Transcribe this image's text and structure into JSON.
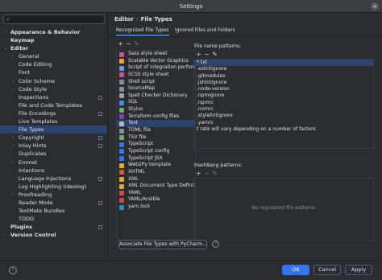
{
  "window": {
    "title": "Settings",
    "close_glyph": "×"
  },
  "search": {
    "glyph": "⌕"
  },
  "tree": [
    {
      "label": "Appearance & Behavior",
      "level": 0,
      "arrow": "›",
      "bold": true
    },
    {
      "label": "Keymap",
      "level": 0,
      "arrow": "",
      "bold": true
    },
    {
      "label": "Editor",
      "level": 0,
      "arrow": "⌄",
      "bold": true
    },
    {
      "label": "General",
      "level": 1,
      "arrow": "›"
    },
    {
      "label": "Code Editing",
      "level": 1,
      "arrow": ""
    },
    {
      "label": "Font",
      "level": 1,
      "arrow": ""
    },
    {
      "label": "Color Scheme",
      "level": 1,
      "arrow": "›"
    },
    {
      "label": "Code Style",
      "level": 1,
      "arrow": "›"
    },
    {
      "label": "Inspections",
      "level": 1,
      "arrow": "",
      "pin": true
    },
    {
      "label": "File and Code Templates",
      "level": 1,
      "arrow": ""
    },
    {
      "label": "File Encodings",
      "level": 1,
      "arrow": "",
      "pin": true
    },
    {
      "label": "Live Templates",
      "level": 1,
      "arrow": ""
    },
    {
      "label": "File Types",
      "level": 1,
      "arrow": "",
      "selected": true
    },
    {
      "label": "Copyright",
      "level": 1,
      "arrow": "›",
      "pin": true
    },
    {
      "label": "Inlay Hints",
      "level": 1,
      "arrow": "›",
      "pin": true
    },
    {
      "label": "Duplicates",
      "level": 1,
      "arrow": ""
    },
    {
      "label": "Emmet",
      "level": 1,
      "arrow": "›"
    },
    {
      "label": "Intentions",
      "level": 1,
      "arrow": ""
    },
    {
      "label": "Language Injections",
      "level": 1,
      "arrow": "",
      "pin": true
    },
    {
      "label": "Log Highlighting (Ideolog)",
      "level": 1,
      "arrow": ""
    },
    {
      "label": "Proofreading",
      "level": 1,
      "arrow": "›"
    },
    {
      "label": "Reader Mode",
      "level": 1,
      "arrow": "",
      "pin": true
    },
    {
      "label": "TextMate Bundles",
      "level": 1,
      "arrow": ""
    },
    {
      "label": "TODO",
      "level": 1,
      "arrow": ""
    },
    {
      "label": "Plugins",
      "level": 0,
      "arrow": "",
      "bold": true,
      "pin": true
    },
    {
      "label": "Version Control",
      "level": 0,
      "arrow": "›",
      "bold": true
    }
  ],
  "breadcrumb": {
    "parent": "Editor",
    "separator": "›",
    "current": "File Types"
  },
  "tabs": {
    "recognized": "Recognized File Types",
    "ignored": "Ignored Files and Folders"
  },
  "toolbar": {
    "add": "+",
    "remove": "−",
    "edit": "✎"
  },
  "file_types": [
    {
      "label": "Sass style sheet",
      "color": "#c6538c"
    },
    {
      "label": "Scalable Vector Graphics",
      "color": "#e8a33d"
    },
    {
      "label": "Script of integration perform",
      "color": "#6f9bd8"
    },
    {
      "label": "SCSS style sheet",
      "color": "#c6538c"
    },
    {
      "label": "Shell script",
      "color": "#8a8d93"
    },
    {
      "label": "SourceMap",
      "color": "#8a8d93"
    },
    {
      "label": "Spell Checker Dictionary",
      "color": "#9aa0a6"
    },
    {
      "label": "SQL",
      "color": "#3d8fd6"
    },
    {
      "label": "Stylus",
      "color": "#6aab73"
    },
    {
      "label": "Terraform config files",
      "color": "#7b42bc"
    },
    {
      "label": "Text",
      "color": "#b4b8bf",
      "selected": true
    },
    {
      "label": "TOML file",
      "color": "#8a8d93"
    },
    {
      "label": "TSV file",
      "color": "#6aab73"
    },
    {
      "label": "TypeScript",
      "color": "#3574f0"
    },
    {
      "label": "TypeScript config",
      "color": "#3574f0"
    },
    {
      "label": "TypeScript JSX",
      "color": "#3574f0"
    },
    {
      "label": "Web2Py template",
      "color": "#e8a33d"
    },
    {
      "label": "XHTML",
      "color": "#d65a31"
    },
    {
      "label": "XML",
      "color": "#d6a83d"
    },
    {
      "label": "XML Document Type Definiti",
      "color": "#d6a83d"
    },
    {
      "label": "YAML",
      "color": "#cb4b4b"
    },
    {
      "label": "YAML/Ansible",
      "color": "#cb4b4b"
    },
    {
      "label": "yarn.lock",
      "color": "#2c8ebb"
    }
  ],
  "patterns": {
    "label": "File name patterns:",
    "items": [
      "*.txt",
      ".eslintignore",
      ".gitmodules",
      ".jshintignore",
      ".node-version",
      ".npmignore",
      ".npmrc",
      ".nvmrc",
      ".stylelintignore",
      ".yarnrc",
      "t rate will vary depending on a number of factors"
    ]
  },
  "hashbang": {
    "label": "HashBang patterns:",
    "empty": "No registered file patterns"
  },
  "buttons": {
    "associate": "Associate File Types with PyCharm...",
    "help": "?",
    "ok": "OK",
    "cancel": "Cancel",
    "apply": "Apply"
  },
  "colors": {
    "accent": "#3574f0",
    "selection": "#2e436e",
    "background": "#2b2d30"
  }
}
